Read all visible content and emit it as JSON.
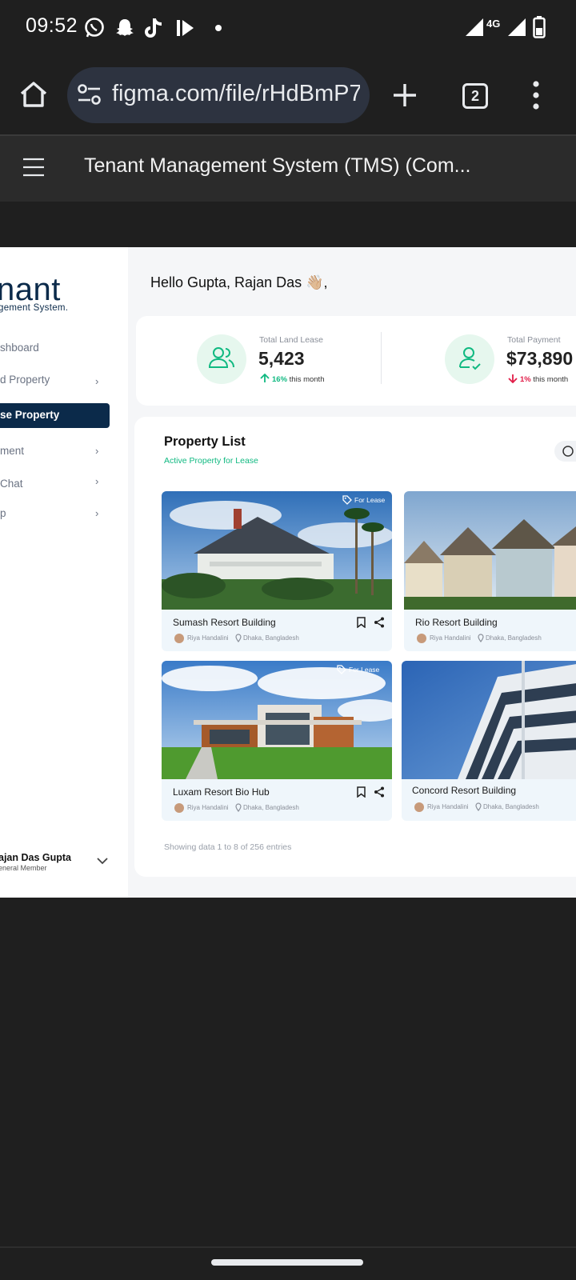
{
  "status_bar": {
    "time": "09:52",
    "network": "4G",
    "icons": [
      "whatsapp-icon",
      "snapchat-icon",
      "tiktok-icon",
      "media-icon",
      "dot-icon",
      "wifi-icon",
      "signal-icon",
      "battery-icon"
    ]
  },
  "browser": {
    "url": "figma.com/file/rHdBmP7",
    "tab_count": "2",
    "icons": [
      "home-icon",
      "site-settings-icon",
      "new-tab-icon",
      "tabs-icon",
      "more-icon"
    ]
  },
  "figma": {
    "title": "Tenant Management System (TMS) (Com..."
  },
  "app": {
    "logo_big": "nant",
    "logo_small": "gement System.",
    "nav": [
      {
        "label": "shboard",
        "chevron": false
      },
      {
        "label": "d Property",
        "chevron": true
      },
      {
        "label": "se Property",
        "chevron": false,
        "active": true
      },
      {
        "label": "ment",
        "chevron": true
      },
      {
        "label": " Chat",
        "chevron": true
      },
      {
        "label": "p",
        "chevron": true
      }
    ],
    "user": {
      "name": "ajan Das Gupta",
      "role": "eneral Member"
    },
    "greeting": "Hello Gupta, Rajan Das 👋🏼,",
    "stats": [
      {
        "label": "Total Land Lease",
        "value": "5,423",
        "change": "16%",
        "change_suffix": "this month",
        "direction": "up",
        "color": "#10b981"
      },
      {
        "label": "Total Payment",
        "value": "$73,890",
        "change": "1%",
        "change_suffix": "this month",
        "direction": "down",
        "color": "#e11d48"
      }
    ],
    "property_list": {
      "title": "Property List",
      "subtitle": "Active Property for Lease",
      "items": [
        {
          "name": "Sumash Resort Building",
          "agent": "Riya Handalini",
          "location": "Dhaka, Bangladesh",
          "badge": "For Lease"
        },
        {
          "name": "Rio Resort Building",
          "agent": "Riya Handalini",
          "location": "Dhaka, Bangladesh",
          "badge": ""
        },
        {
          "name": "Luxam Resort Bio Hub",
          "agent": "Riya Handalini",
          "location": "Dhaka, Bangladesh",
          "badge": "For Lease"
        },
        {
          "name": "Concord Resort Building",
          "agent": "Riya Handalini",
          "location": "Dhaka, Bangladesh",
          "badge": ""
        }
      ],
      "footer": "Showing data 1 to 8 of  256 entries"
    }
  }
}
